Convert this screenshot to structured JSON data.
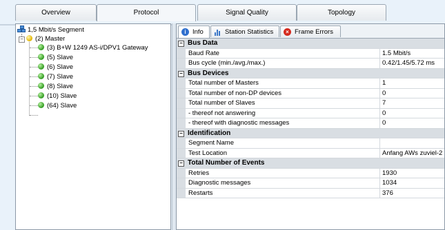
{
  "tabs": [
    {
      "label": "Overview"
    },
    {
      "label": "Protocol"
    },
    {
      "label": "Signal Quality"
    },
    {
      "label": "Topology"
    }
  ],
  "tree": {
    "root": "1,5 Mbit/s Segment",
    "master": "(2) Master",
    "children": [
      "(3) B+W 1249 AS-i/DPV1 Gateway",
      "(5) Slave",
      "(6) Slave",
      "(7) Slave",
      "(8) Slave",
      "(10) Slave",
      "(64) Slave"
    ]
  },
  "subtabs": [
    {
      "label": "Info",
      "icon": "info-icon"
    },
    {
      "label": "Station Statistics",
      "icon": "bar-chart-icon"
    },
    {
      "label": "Frame Errors",
      "icon": "error-icon"
    }
  ],
  "grid": [
    {
      "category": "Bus Data",
      "rows": [
        {
          "label": "Baud Rate",
          "value": "1.5 Mbit/s"
        },
        {
          "label": "Bus cycle (min./avg./max.)",
          "value": "0.42/1.45/5.72 ms"
        }
      ]
    },
    {
      "category": "Bus Devices",
      "rows": [
        {
          "label": "Total number of Masters",
          "value": "1"
        },
        {
          "label": "Total number of non-DP devices",
          "value": "0"
        },
        {
          "label": "Total number of Slaves",
          "value": "7"
        },
        {
          "label": "- thereof not answering",
          "value": "0"
        },
        {
          "label": "- thereof with diagnostic messages",
          "value": "0"
        }
      ]
    },
    {
      "category": "Identification",
      "rows": [
        {
          "label": "Segment Name",
          "value": ""
        },
        {
          "label": "Test Location",
          "value": "Anfang AWs zuviel-2"
        }
      ]
    },
    {
      "category": "Total Number of Events",
      "rows": [
        {
          "label": "Retries",
          "value": "1930"
        },
        {
          "label": "Diagnostic messages",
          "value": "1034"
        },
        {
          "label": "Restarts",
          "value": "376"
        }
      ]
    }
  ]
}
